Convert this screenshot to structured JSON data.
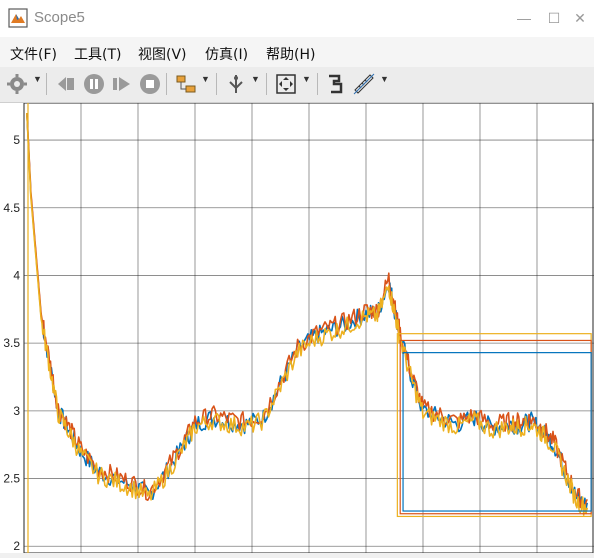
{
  "window": {
    "title": "Scope5"
  },
  "menu": [
    {
      "label": "文件(F)"
    },
    {
      "label": "工具(T)"
    },
    {
      "label": "视图(V)"
    },
    {
      "label": "仿真(I)"
    },
    {
      "label": "帮助(H)"
    }
  ],
  "toolbar": {
    "icons": [
      "gear-icon",
      "step-back-icon",
      "pause-icon",
      "step-forward-icon",
      "stop-icon",
      "signal-selector-icon",
      "trigger-icon",
      "zoom-fit-icon",
      "highlight-block-icon",
      "measure-ruler-icon"
    ]
  },
  "chart_data": {
    "type": "line",
    "yticks": [
      "5",
      "4.5",
      "4",
      "3.5",
      "3",
      "2.5",
      "2"
    ],
    "ylim": [
      1.95,
      5.2
    ],
    "xlim": [
      0,
      10
    ],
    "grid": true,
    "colors": {
      "series1": "#0072bd",
      "series2": "#d95319",
      "series3": "#edb120"
    },
    "series": [
      {
        "color": "#0072bd",
        "x": [
          0.05,
          0.08,
          0.12,
          0.2,
          0.3,
          0.45,
          0.6,
          0.8,
          1.0,
          1.3,
          1.6,
          1.9,
          2.2,
          2.5,
          2.8,
          3.0,
          3.3,
          3.6,
          3.9,
          4.2,
          4.5,
          4.8,
          5.1,
          5.4,
          5.7,
          6.0,
          6.2,
          6.4,
          6.5,
          6.6,
          6.8,
          7.0,
          7.3,
          7.6,
          7.9,
          8.2,
          8.5,
          8.7,
          8.9,
          9.1,
          9.3,
          9.5,
          9.7,
          9.9
        ],
        "y": [
          5.2,
          4.95,
          4.6,
          4.2,
          3.7,
          3.35,
          3.0,
          2.85,
          2.7,
          2.55,
          2.5,
          2.45,
          2.38,
          2.55,
          2.75,
          2.9,
          2.95,
          2.92,
          2.9,
          2.95,
          3.2,
          3.45,
          3.55,
          3.6,
          3.65,
          3.72,
          3.72,
          3.95,
          3.75,
          3.55,
          3.25,
          3.0,
          2.95,
          2.9,
          2.95,
          2.88,
          2.9,
          2.9,
          2.92,
          2.85,
          2.75,
          2.55,
          2.35,
          2.3
        ]
      },
      {
        "color": "#d95319",
        "x": [
          0.05,
          0.08,
          0.12,
          0.2,
          0.3,
          0.45,
          0.6,
          0.8,
          1.0,
          1.3,
          1.6,
          1.9,
          2.2,
          2.5,
          2.8,
          3.0,
          3.3,
          3.6,
          3.9,
          4.2,
          4.5,
          4.8,
          5.1,
          5.4,
          5.7,
          6.0,
          6.2,
          6.4,
          6.5,
          6.6,
          6.8,
          7.0,
          7.3,
          7.6,
          7.9,
          8.2,
          8.5,
          8.7,
          8.9,
          9.1,
          9.3,
          9.5,
          9.7,
          9.9
        ],
        "y": [
          5.2,
          4.97,
          4.62,
          4.22,
          3.72,
          3.37,
          3.02,
          2.87,
          2.72,
          2.57,
          2.52,
          2.47,
          2.4,
          2.57,
          2.77,
          2.92,
          2.97,
          2.94,
          2.92,
          2.97,
          3.22,
          3.47,
          3.57,
          3.62,
          3.67,
          3.74,
          3.74,
          3.98,
          3.77,
          3.57,
          3.27,
          3.02,
          2.97,
          2.92,
          2.97,
          2.9,
          2.92,
          2.92,
          2.94,
          2.87,
          2.77,
          2.57,
          2.37,
          2.32
        ]
      },
      {
        "color": "#edb120",
        "x": [
          0.05,
          0.08,
          0.12,
          0.2,
          0.3,
          0.45,
          0.6,
          0.8,
          1.0,
          1.3,
          1.6,
          1.9,
          2.2,
          2.5,
          2.8,
          3.0,
          3.3,
          3.6,
          3.9,
          4.2,
          4.5,
          4.8,
          5.1,
          5.4,
          5.7,
          6.0,
          6.2,
          6.4,
          6.5,
          6.6,
          6.8,
          7.0,
          7.3,
          7.6,
          7.9,
          8.2,
          8.5,
          8.7,
          8.9,
          9.1,
          9.3,
          9.5,
          9.7,
          9.9
        ],
        "y": [
          5.2,
          4.93,
          4.58,
          4.18,
          3.68,
          3.33,
          2.98,
          2.83,
          2.68,
          2.53,
          2.48,
          2.43,
          2.36,
          2.53,
          2.73,
          2.88,
          2.93,
          2.9,
          2.88,
          2.93,
          3.18,
          3.43,
          3.53,
          3.58,
          3.63,
          3.7,
          3.7,
          3.92,
          3.73,
          3.53,
          3.23,
          2.98,
          2.93,
          2.88,
          2.93,
          2.86,
          2.88,
          2.88,
          2.9,
          2.83,
          2.73,
          2.53,
          2.33,
          2.28
        ]
      }
    ],
    "markers": {
      "boxes": [
        {
          "color": "#edb120",
          "x": [
            6.55,
            9.95
          ],
          "y": [
            2.22,
            3.57
          ]
        },
        {
          "color": "#d95319",
          "x": [
            6.6,
            9.95
          ],
          "y": [
            2.24,
            3.52
          ]
        },
        {
          "color": "#0072bd",
          "x": [
            6.65,
            9.95
          ],
          "y": [
            2.26,
            3.43
          ]
        }
      ]
    }
  }
}
